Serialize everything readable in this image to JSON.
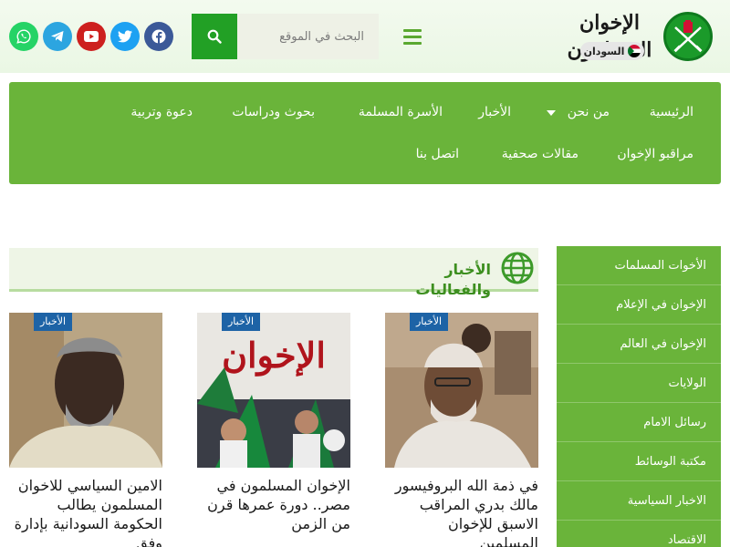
{
  "header": {
    "logo_title": "الإخوان المسلمون",
    "logo_subtitle": "السودان",
    "search": {
      "placeholder": "البحث في الموقع"
    },
    "social": [
      {
        "name": "facebook",
        "icon": "facebook-icon",
        "color": "#3b5998"
      },
      {
        "name": "twitter",
        "icon": "twitter-icon",
        "color": "#1da1f2"
      },
      {
        "name": "youtube",
        "icon": "youtube-icon",
        "color": "#cd201f"
      },
      {
        "name": "telegram",
        "icon": "telegram-icon",
        "color": "#2ca5e0"
      },
      {
        "name": "whatsapp",
        "icon": "whatsapp-icon",
        "color": "#25d366"
      }
    ]
  },
  "nav": {
    "items": [
      "الرئيسية",
      "من نحن",
      "الأخبار",
      "الأسرة المسلمة",
      "بحوث ودراسات",
      "دعوة وتربية",
      "مراقبو الإخوان",
      "مقالات صحفية",
      "اتصل بنا"
    ]
  },
  "news": {
    "section_title": "الأخبار والفعاليات",
    "cards": [
      {
        "badge": "الأخبار",
        "title": "في ذمة الله البروفيسور مالك بدري المراقب الاسبق للإخوان المسلمين"
      },
      {
        "badge": "الأخبار",
        "title": "الإخوان المسلمون في مصر.. دورة عمرها قرن من الزمن"
      },
      {
        "badge": "الأخبار",
        "title": "الامين السياسي للاخوان المسلمون يطالب الحكومة السودانية بإدارة وفق"
      }
    ]
  },
  "sidebar": {
    "items": [
      "الأخوات المسلمات",
      "الإخوان في الإعلام",
      "الإخوان في العالم",
      "الولايات",
      "رسائل الامام",
      "مكتبة الوسائط",
      "الاخبار السياسية",
      "الاقتصاد"
    ]
  },
  "colors": {
    "brand_green": "#6ab43a",
    "search_green": "#22a025",
    "badge_blue": "#1d63a6",
    "title_green": "#3d8f20"
  }
}
